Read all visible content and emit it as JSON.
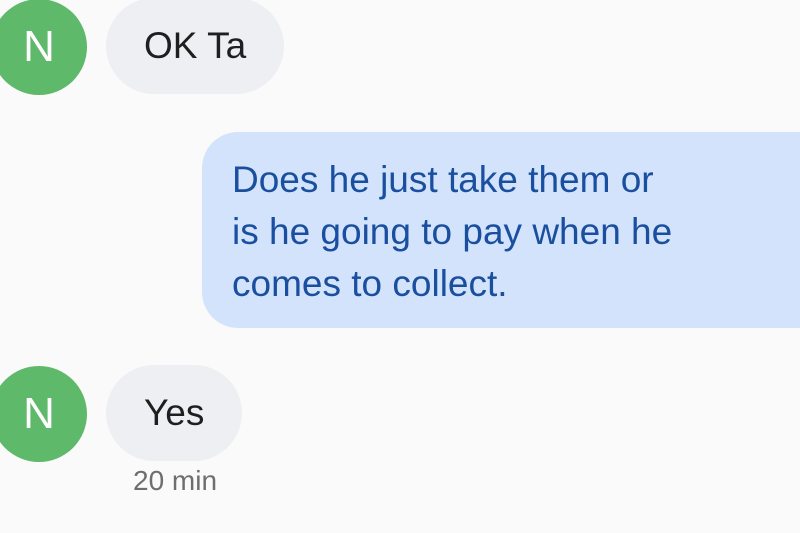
{
  "messages": [
    {
      "sender_initial": "N",
      "text": "OK Ta"
    },
    {
      "lines": [
        "Does he just take them or",
        "is he going to pay when he",
        "comes to collect."
      ]
    },
    {
      "sender_initial": "N",
      "text": "Yes",
      "time": "20 min"
    }
  ],
  "colors": {
    "avatar": "#5fb96a",
    "incoming_bubble": "#eeeff2",
    "outgoing_bubble": "#d3e3fb",
    "outgoing_text": "#1a4fa0"
  }
}
